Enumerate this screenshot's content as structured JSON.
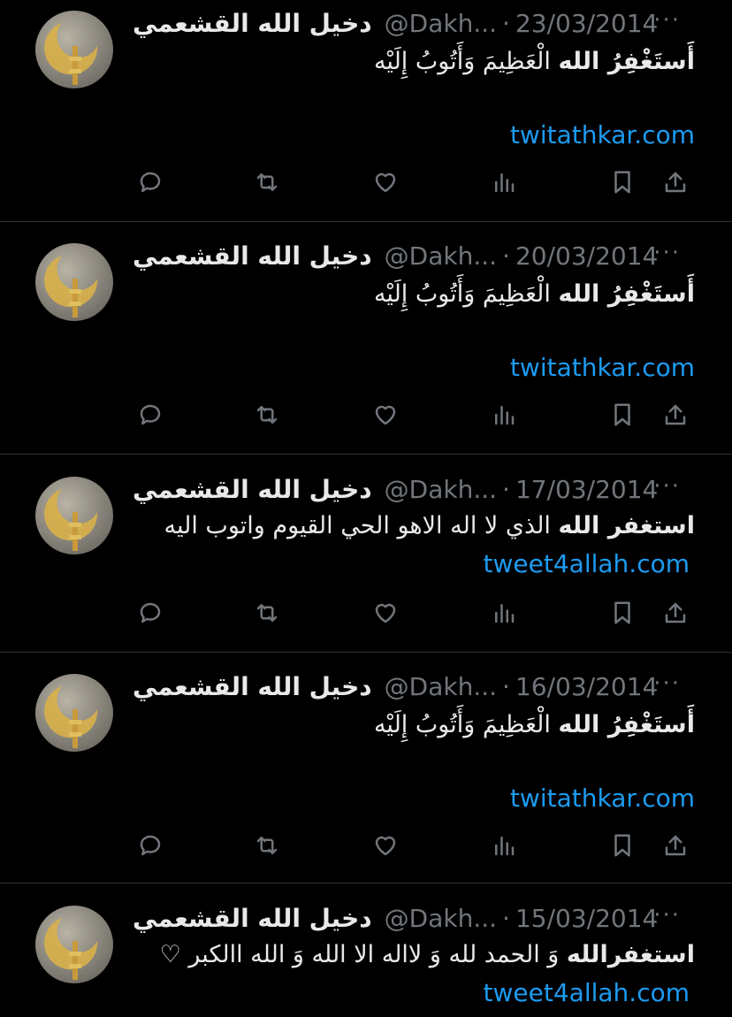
{
  "tweets": [
    {
      "name": "دخيل الله القشعمي",
      "handle": "@Dakh...",
      "dot": "·",
      "date": "23/03/2014",
      "more": "···",
      "text_bold": "أَستَغْفِرُ الله",
      "text_rest": " الْعَظِيمَ وَأَتُوبُ إِلَيْه",
      "link": "twitathkar.com"
    },
    {
      "name": "دخيل الله القشعمي",
      "handle": "@Dakh...",
      "dot": "·",
      "date": "20/03/2014",
      "more": "···",
      "text_bold": "أَستَغْفِرُ الله",
      "text_rest": " الْعَظِيمَ وَأَتُوبُ إِلَيْه",
      "link": "twitathkar.com"
    },
    {
      "name": "دخيل الله القشعمي",
      "handle": "@Dakh...",
      "dot": "·",
      "date": "17/03/2014",
      "more": "···",
      "text_bold": "استغفر الله",
      "text_rest": " الذي لا اله الاهو الحي القيوم واتوب اليه",
      "link": "tweet4allah.com"
    },
    {
      "name": "دخيل الله القشعمي",
      "handle": "@Dakh...",
      "dot": "·",
      "date": "16/03/2014",
      "more": "···",
      "text_bold": "أَستَغْفِرُ الله",
      "text_rest": " الْعَظِيمَ وَأَتُوبُ إِلَيْه",
      "link": "twitathkar.com"
    },
    {
      "name": "دخيل الله القشعمي",
      "handle": "@Dakh...",
      "dot": "·",
      "date": "15/03/2014",
      "more": "···",
      "text_bold": "استغفرالله",
      "text_rest": " وَ الحمد لله وَ لااله الا الله وَ الله االكبر ♡",
      "link": "tweet4allah.com"
    }
  ],
  "icons": {
    "reply": "reply-icon",
    "retweet": "retweet-icon",
    "like": "heart-icon",
    "views": "views-icon",
    "bookmark": "bookmark-icon",
    "share": "share-icon"
  },
  "colors": {
    "link": "#1d9bf0",
    "muted": "#71767b",
    "text": "#e7e9ea",
    "divider": "#2f3336"
  }
}
